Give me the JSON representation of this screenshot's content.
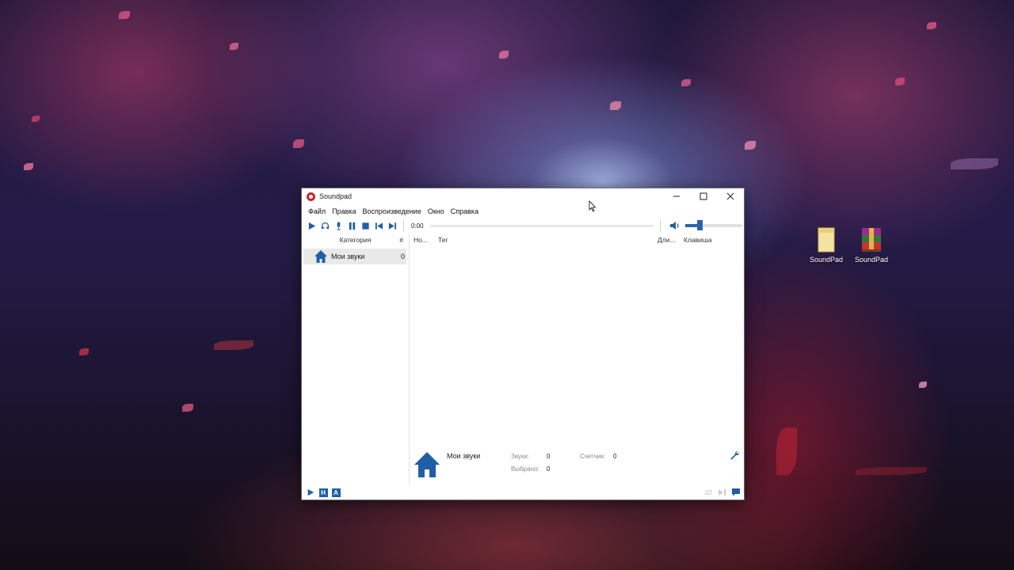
{
  "window": {
    "title": "Soundpad",
    "controls": {
      "minimize": "—",
      "maximize": "☐",
      "close": "✕"
    }
  },
  "menu": [
    "Файл",
    "Правка",
    "Воспроизведение",
    "Окно",
    "Справка"
  ],
  "toolbar": {
    "icons": [
      "play-icon",
      "headphones-icon",
      "microphone-icon",
      "pause-icon",
      "stop-icon",
      "previous-icon",
      "next-icon"
    ],
    "time": "0:00",
    "volume_level": 0.25
  },
  "sidebar": {
    "header": "Категория",
    "count_header": "#",
    "categories": [
      {
        "label": "Мои звуки",
        "count": "0",
        "icon": "home-icon"
      }
    ]
  },
  "table": {
    "columns": [
      "Но...",
      "Тег",
      "Дли...",
      "Клавиша"
    ]
  },
  "footer": {
    "category_name": "Мои звуки",
    "sounds_label": "Звуки:",
    "sounds_value": "0",
    "selected_label": "Выбрано:",
    "selected_value": "0",
    "counter_label": "Счетчик:",
    "counter_value": "0"
  },
  "statusbar": {
    "left": [
      "play-icon",
      "H",
      "A"
    ],
    "right": [
      "repeat-icon",
      "skip-icon",
      "chat-icon"
    ]
  },
  "desktop_icons": [
    {
      "label": "SoundPad",
      "icon": "folder-icon"
    },
    {
      "label": "SoundPad",
      "icon": "winrar-archive-icon"
    }
  ],
  "colors": {
    "accent": "#1f5fa6",
    "brand": "#c9242d"
  }
}
